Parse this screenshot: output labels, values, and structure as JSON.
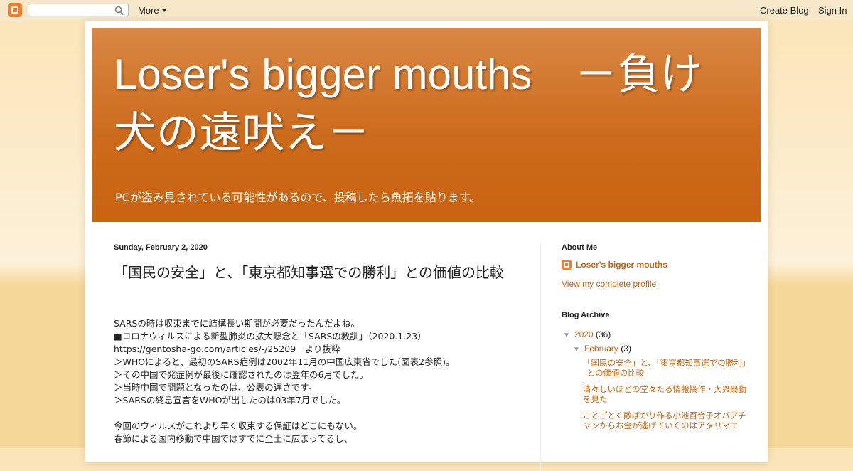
{
  "navbar": {
    "search_placeholder": "",
    "more_label": "More",
    "create_blog_label": "Create Blog",
    "sign_in_label": "Sign In"
  },
  "header": {
    "title": "Loser's bigger mouths　－負け犬の遠吠え－",
    "description": "PCが盗み見されている可能性があるので、投稿したら魚拓を貼ります。"
  },
  "post": {
    "date": "Sunday, February 2, 2020",
    "title": "「国民の安全」と、「東京都知事選での勝利」との価値の比較",
    "body_lines": [
      "SARSの時は収束までに結構長い期間が必要だったんだよね。",
      "■コロナウィルスによる新型肺炎の拡大懸念と「SARSの教訓」（2020.1.23）",
      "https://gentosha-go.com/articles/-/25209　より抜粋",
      "＞WHOによると、最初のSARS症例は2002年11月の中国広東省でした(図表2参照)。",
      "＞その中国で発症例が最後に確認されたのは翌年の6月でした。",
      "＞当時中国で問題となったのは、公表の遅さです。",
      "＞SARSの終息宣言をWHOが出したのは03年7月でした。",
      "",
      "今回のウィルスがこれより早く収束する保証はどこにもない。",
      "春節による国内移動で中国ではすでに全土に広まってるし、"
    ]
  },
  "sidebar": {
    "about_title": "About Me",
    "profile_name": "Loser's bigger mouths",
    "view_profile": "View my complete profile",
    "archive_title": "Blog Archive",
    "year": {
      "label": "2020",
      "count": "(36)",
      "toggle": "▼"
    },
    "month": {
      "label": "February",
      "count": "(3)",
      "toggle": "▼"
    },
    "posts": [
      "「国民の安全」と、「東京都知事選での勝利」との価値の比較",
      "清々しいほどの堂々たる情報操作・大衆扇動を見た",
      "ことごとく敵ばかり作る小池百合子オバアチャンからお金が逃げていくのはアタリマエ"
    ]
  },
  "colors": {
    "accent": "#cc6611",
    "header_top": "#d98743",
    "header_bottom": "#c96310",
    "navbar_bg": "#f6e7c8"
  }
}
